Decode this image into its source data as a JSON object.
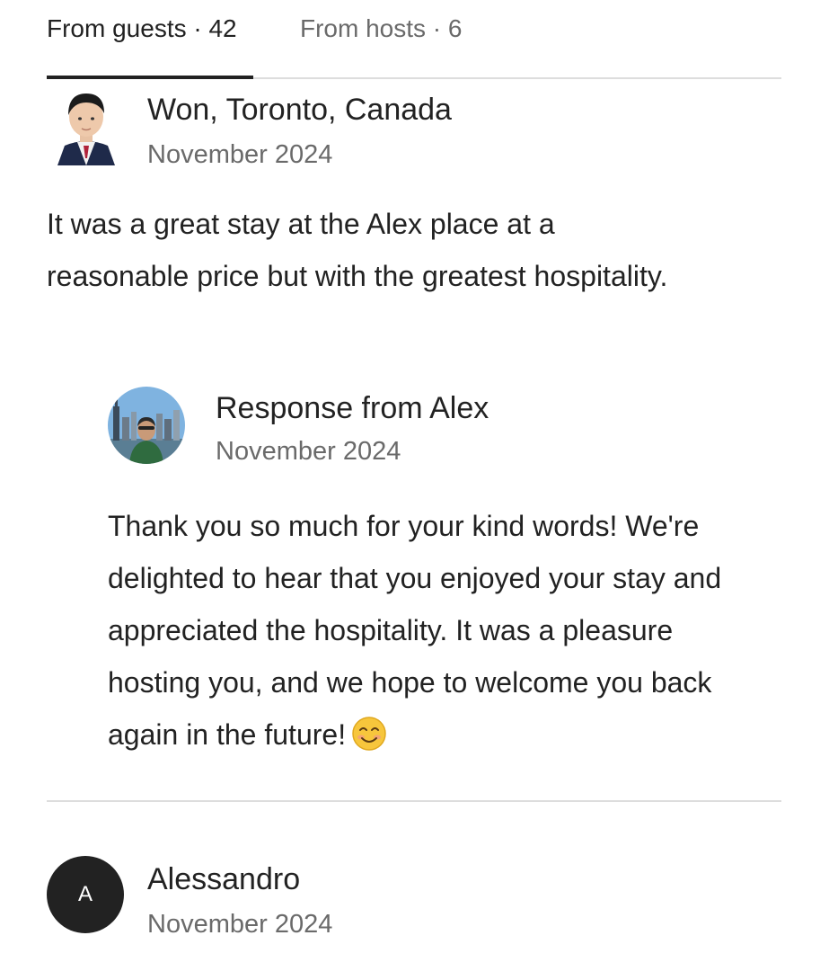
{
  "tabs": {
    "guests_label": "From guests · 42",
    "hosts_label": "From hosts · 6",
    "active": "guests"
  },
  "reviews": [
    {
      "reviewer": "Won, Toronto, Canada",
      "date": "November 2024",
      "text": "It was a great stay at the Alex place at a reasonable price but with the greatest hospitality.",
      "avatar": "photo-avatar",
      "response": {
        "title": "Response from Alex",
        "date": "November 2024",
        "text": "Thank you so much for your kind words! We're delighted to hear that you enjoyed your stay and appreciated the hospitality. It was a pleasure hosting you, and we hope to welcome you back again in the future!",
        "emoji_icon": "smiling-face-icon",
        "avatar": "photo-avatar"
      }
    },
    {
      "reviewer": "Alessandro",
      "date": "November 2024",
      "avatar_initial": "A"
    }
  ],
  "colors": {
    "text_primary": "#222222",
    "text_secondary": "#6a6a6a",
    "divider": "#dddddd",
    "initial_avatar_bg": "#222222"
  }
}
